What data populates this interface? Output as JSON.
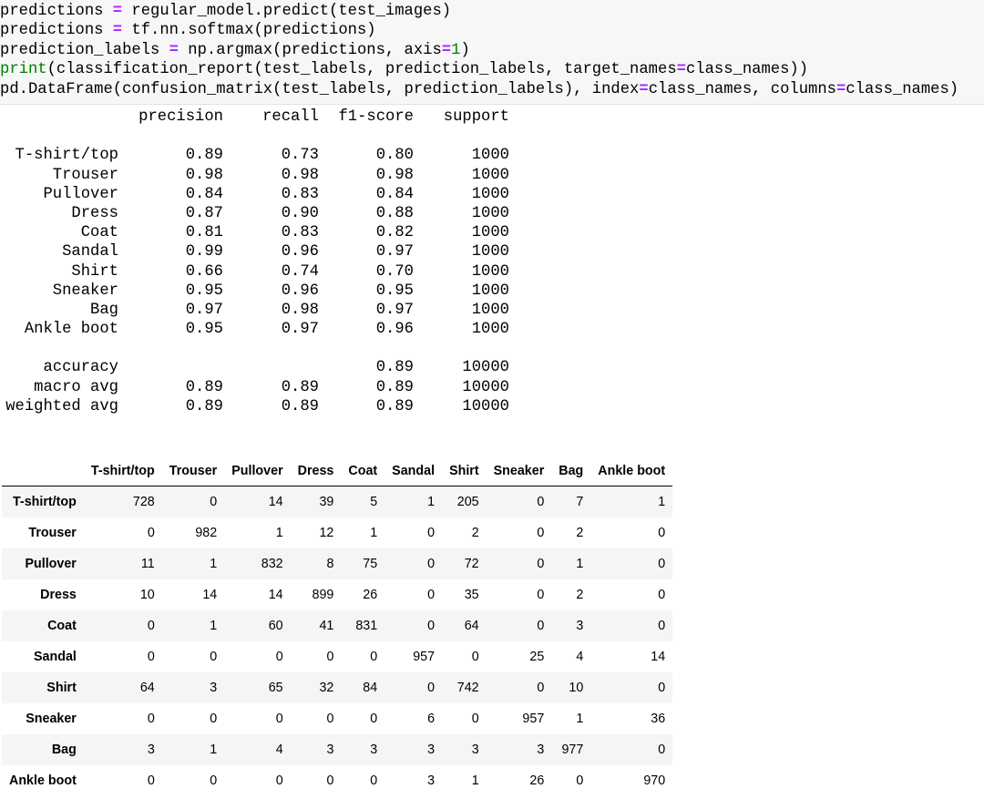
{
  "code_lines": [
    [
      {
        "t": "predictions "
      },
      {
        "t": "=",
        "c": "op"
      },
      {
        "t": " regular_model.predict(test_images)"
      }
    ],
    [
      {
        "t": "predictions "
      },
      {
        "t": "=",
        "c": "op"
      },
      {
        "t": " tf.nn.softmax(predictions)"
      }
    ],
    [
      {
        "t": "prediction_labels "
      },
      {
        "t": "=",
        "c": "op"
      },
      {
        "t": " np.argmax(predictions, axis"
      },
      {
        "t": "=",
        "c": "op"
      },
      {
        "t": "1",
        "c": "num"
      },
      {
        "t": ")"
      }
    ],
    [
      {
        "t": "print",
        "c": "bi"
      },
      {
        "t": "(classification_report(test_labels, prediction_labels, target_names"
      },
      {
        "t": "=",
        "c": "op"
      },
      {
        "t": "class_names))"
      }
    ],
    [
      {
        "t": "pd.DataFrame(confusion_matrix(test_labels, prediction_labels), index"
      },
      {
        "t": "=",
        "c": "op"
      },
      {
        "t": "class_names, columns"
      },
      {
        "t": "=",
        "c": "op"
      },
      {
        "t": "class_names)"
      }
    ]
  ],
  "report": {
    "headers": [
      "precision",
      "recall",
      "f1-score",
      "support"
    ],
    "rows": [
      {
        "label": "T-shirt/top",
        "precision": "0.89",
        "recall": "0.73",
        "f1": "0.80",
        "support": "1000"
      },
      {
        "label": "Trouser",
        "precision": "0.98",
        "recall": "0.98",
        "f1": "0.98",
        "support": "1000"
      },
      {
        "label": "Pullover",
        "precision": "0.84",
        "recall": "0.83",
        "f1": "0.84",
        "support": "1000"
      },
      {
        "label": "Dress",
        "precision": "0.87",
        "recall": "0.90",
        "f1": "0.88",
        "support": "1000"
      },
      {
        "label": "Coat",
        "precision": "0.81",
        "recall": "0.83",
        "f1": "0.82",
        "support": "1000"
      },
      {
        "label": "Sandal",
        "precision": "0.99",
        "recall": "0.96",
        "f1": "0.97",
        "support": "1000"
      },
      {
        "label": "Shirt",
        "precision": "0.66",
        "recall": "0.74",
        "f1": "0.70",
        "support": "1000"
      },
      {
        "label": "Sneaker",
        "precision": "0.95",
        "recall": "0.96",
        "f1": "0.95",
        "support": "1000"
      },
      {
        "label": "Bag",
        "precision": "0.97",
        "recall": "0.98",
        "f1": "0.97",
        "support": "1000"
      },
      {
        "label": "Ankle boot",
        "precision": "0.95",
        "recall": "0.97",
        "f1": "0.96",
        "support": "1000"
      }
    ],
    "summary": [
      {
        "label": "accuracy",
        "precision": "",
        "recall": "",
        "f1": "0.89",
        "support": "10000"
      },
      {
        "label": "macro avg",
        "precision": "0.89",
        "recall": "0.89",
        "f1": "0.89",
        "support": "10000"
      },
      {
        "label": "weighted avg",
        "precision": "0.89",
        "recall": "0.89",
        "f1": "0.89",
        "support": "10000"
      }
    ]
  },
  "confusion_matrix": {
    "columns": [
      "T-shirt/top",
      "Trouser",
      "Pullover",
      "Dress",
      "Coat",
      "Sandal",
      "Shirt",
      "Sneaker",
      "Bag",
      "Ankle boot"
    ],
    "rows": [
      {
        "label": "T-shirt/top",
        "values": [
          728,
          0,
          14,
          39,
          5,
          1,
          205,
          0,
          7,
          1
        ]
      },
      {
        "label": "Trouser",
        "values": [
          0,
          982,
          1,
          12,
          1,
          0,
          2,
          0,
          2,
          0
        ]
      },
      {
        "label": "Pullover",
        "values": [
          11,
          1,
          832,
          8,
          75,
          0,
          72,
          0,
          1,
          0
        ]
      },
      {
        "label": "Dress",
        "values": [
          10,
          14,
          14,
          899,
          26,
          0,
          35,
          0,
          2,
          0
        ]
      },
      {
        "label": "Coat",
        "values": [
          0,
          1,
          60,
          41,
          831,
          0,
          64,
          0,
          3,
          0
        ]
      },
      {
        "label": "Sandal",
        "values": [
          0,
          0,
          0,
          0,
          0,
          957,
          0,
          25,
          4,
          14
        ]
      },
      {
        "label": "Shirt",
        "values": [
          64,
          3,
          65,
          32,
          84,
          0,
          742,
          0,
          10,
          0
        ]
      },
      {
        "label": "Sneaker",
        "values": [
          0,
          0,
          0,
          0,
          0,
          6,
          0,
          957,
          1,
          36
        ]
      },
      {
        "label": "Bag",
        "values": [
          3,
          1,
          4,
          3,
          3,
          3,
          3,
          3,
          977,
          0
        ]
      },
      {
        "label": "Ankle boot",
        "values": [
          0,
          0,
          0,
          0,
          0,
          3,
          1,
          26,
          0,
          970
        ]
      }
    ]
  }
}
